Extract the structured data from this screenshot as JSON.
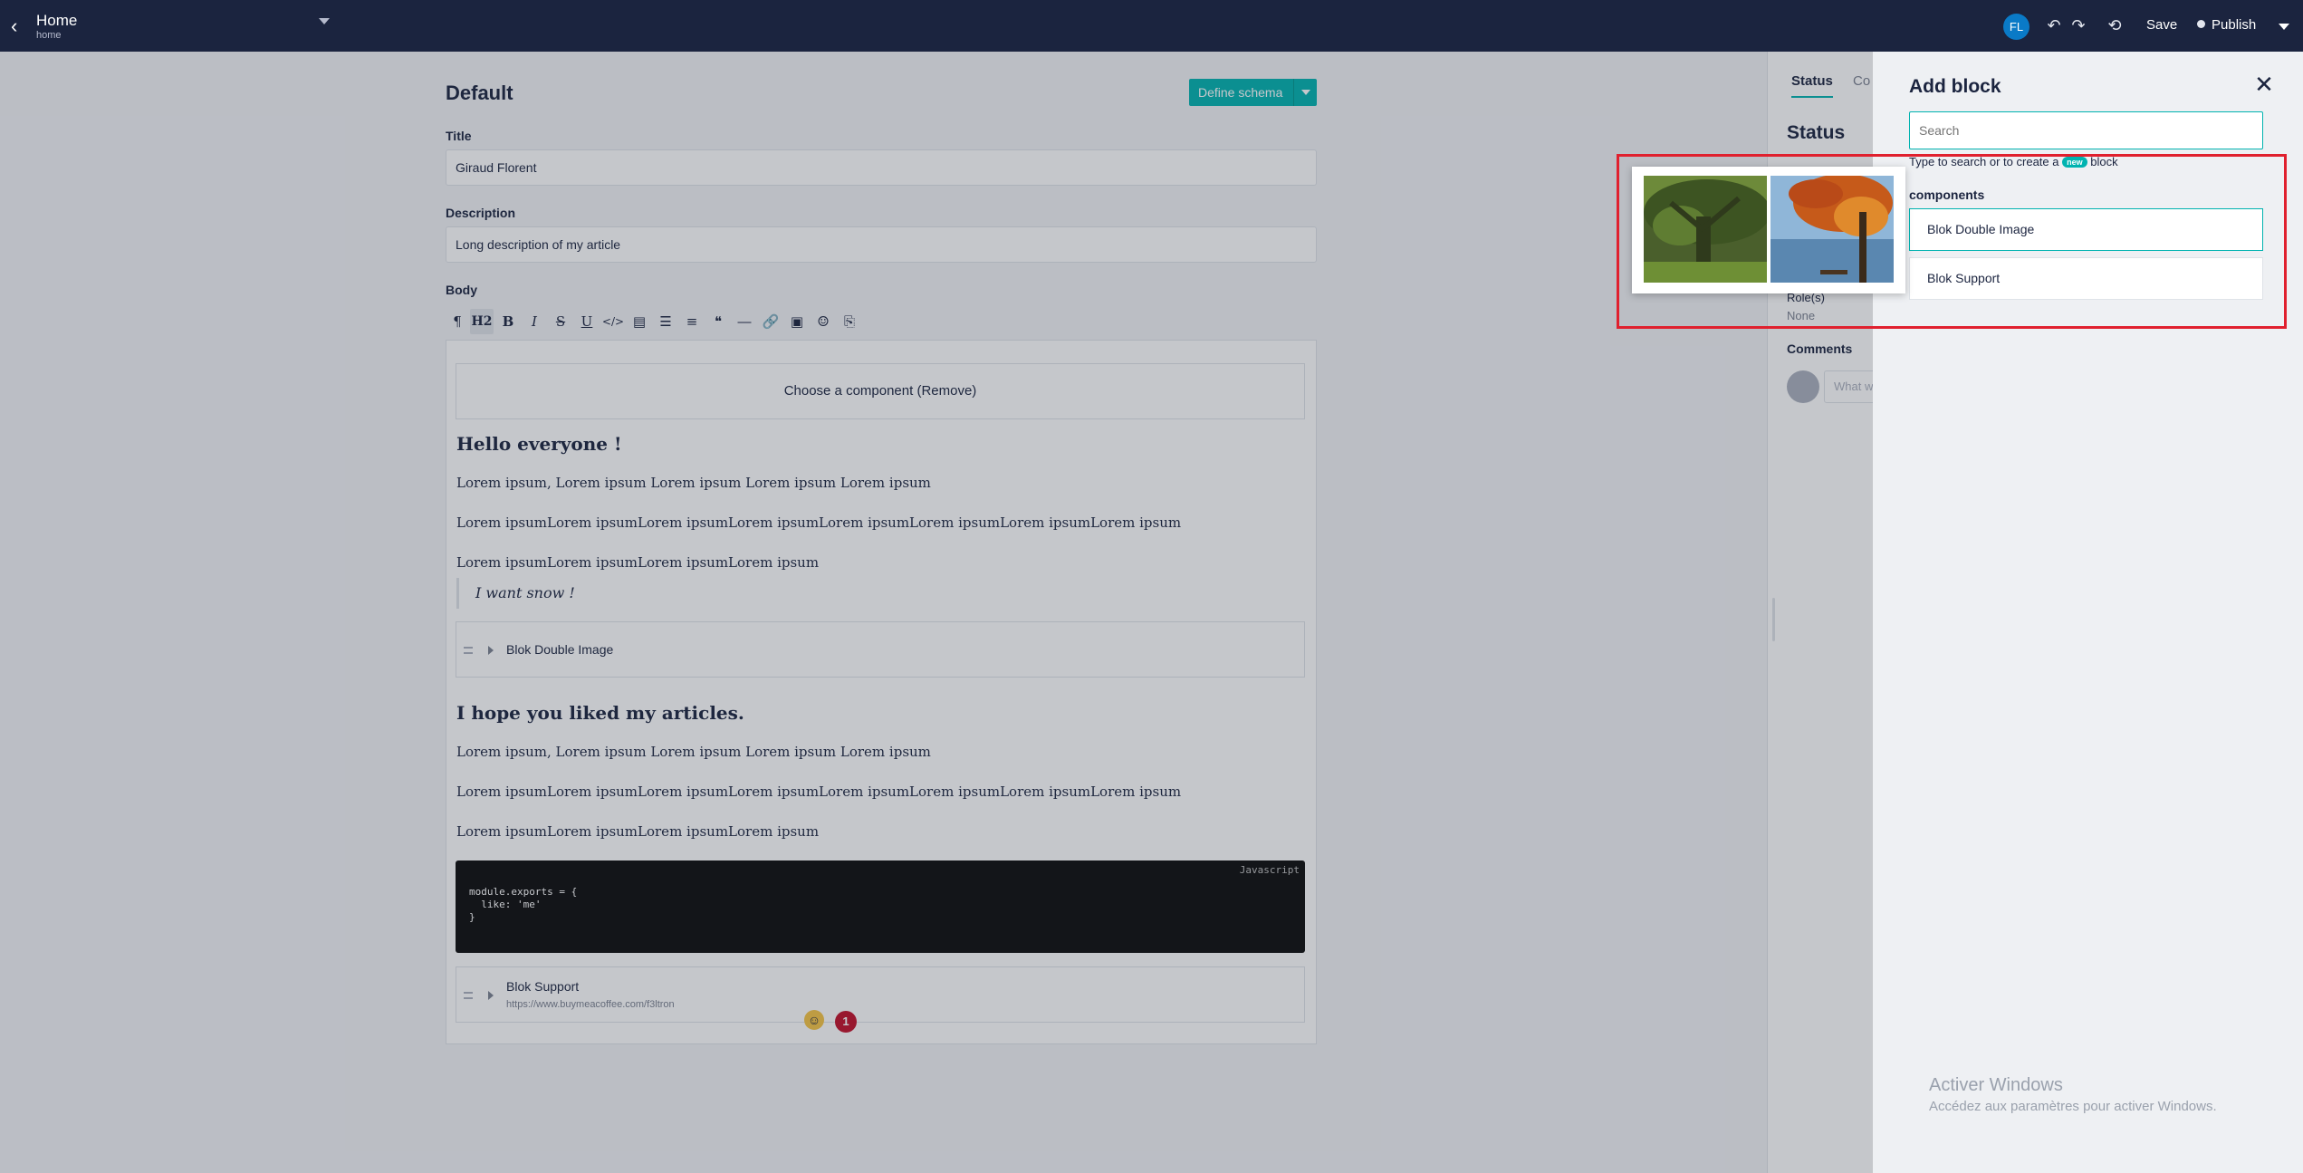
{
  "topbar": {
    "title": "Home",
    "slug": "home",
    "avatar_initials": "FL",
    "save_label": "Save",
    "publish_label": "Publish"
  },
  "editor": {
    "content_type": "Default",
    "define_schema_label": "Define schema",
    "fields": {
      "title_label": "Title",
      "title_value": "Giraud Florent",
      "description_label": "Description",
      "description_value": "Long description of my article",
      "body_label": "Body"
    },
    "toolbar_items": [
      "paragraph",
      "H2",
      "bold",
      "italic",
      "strike",
      "underline",
      "code",
      "code-block",
      "bullet-list",
      "ordered-list",
      "quote",
      "horizontal-rule",
      "link",
      "image",
      "emoji",
      "paste"
    ],
    "body": {
      "choose_component": "Choose a component (Remove)",
      "heading1": "Hello everyone !",
      "p1": "Lorem ipsum, Lorem ipsum Lorem ipsum Lorem ipsum Lorem ipsum",
      "p2": "Lorem ipsumLorem ipsumLorem ipsumLorem ipsumLorem ipsumLorem ipsumLorem ipsumLorem ipsum",
      "p3": "Lorem ipsumLorem ipsumLorem ipsumLorem ipsum",
      "quote": "I want snow !",
      "blok1": "Blok Double Image",
      "heading2": "I hope you liked my articles.",
      "p4": "Lorem ipsum, Lorem ipsum Lorem ipsum Lorem ipsum Lorem ipsum",
      "p5": "Lorem ipsumLorem ipsumLorem ipsumLorem ipsumLorem ipsumLorem ipsumLorem ipsumLorem ipsum",
      "p6": "Lorem ipsumLorem ipsumLorem ipsumLorem ipsum",
      "code_lang": "Javascript",
      "code": "module.exports = {\n  like: 'me'\n}",
      "blok2": "Blok Support",
      "blok2_url": "https://www.buymeacoffee.com/f3ltron",
      "notif_count": "1"
    }
  },
  "status_panel": {
    "tab_status": "Status",
    "tab_other": "Co",
    "title": "Status",
    "roles_label": "Role(s)",
    "roles_value": "None",
    "comments_label": "Comments",
    "comment_placeholder": "What w"
  },
  "add_block": {
    "title": "Add block",
    "search_placeholder": "Search",
    "hint_before": "Type to search or to create a",
    "hint_badge": "new",
    "hint_after": "block",
    "section": "components",
    "items": [
      "Blok Double Image",
      "Blok Support"
    ]
  },
  "watermark": {
    "line1": "Activer Windows",
    "line2": "Accédez aux paramètres pour activer Windows."
  },
  "colors": {
    "topbar": "#1b243f",
    "accent": "#00b3b0",
    "highlight": "#e0202e"
  }
}
